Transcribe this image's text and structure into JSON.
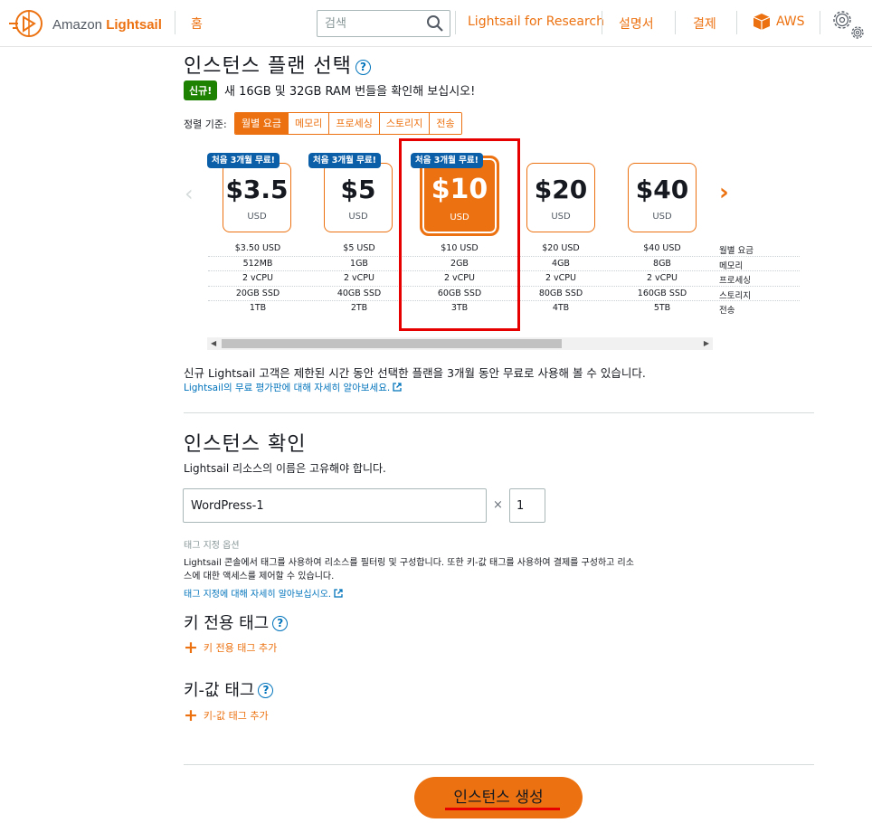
{
  "header": {
    "brand_prefix": "Amazon ",
    "brand_name": "Lightsail",
    "home": "홈",
    "search_placeholder": "검색",
    "research": "Lightsail for Research",
    "docs": "설명서",
    "billing": "결제",
    "aws": "AWS"
  },
  "plans_section": {
    "title": "인스턴스 플랜 선택",
    "help": "?",
    "new_badge": "신규!",
    "new_text": "새 16GB 및 32GB RAM 번들을 확인해 보십시오!",
    "sort_label": "정렬 기준:",
    "sort_options": [
      "월별 요금",
      "메모리",
      "프로세싱",
      "스토리지",
      "전송"
    ],
    "sort_active": "월별 요금",
    "promo": "처음 3개월 무료!",
    "plans": [
      {
        "price": "$3.5",
        "currency": "USD",
        "monthly": "$3.50 USD",
        "memory": "512MB",
        "processing": "2 vCPU",
        "storage": "20GB SSD",
        "transfer": "1TB",
        "promo": true
      },
      {
        "price": "$5",
        "currency": "USD",
        "monthly": "$5 USD",
        "memory": "1GB",
        "processing": "2 vCPU",
        "storage": "40GB SSD",
        "transfer": "2TB",
        "promo": true
      },
      {
        "price": "$10",
        "currency": "USD",
        "monthly": "$10 USD",
        "memory": "2GB",
        "processing": "2 vCPU",
        "storage": "60GB SSD",
        "transfer": "3TB",
        "promo": true,
        "selected": true
      },
      {
        "price": "$20",
        "currency": "USD",
        "monthly": "$20 USD",
        "memory": "4GB",
        "processing": "2 vCPU",
        "storage": "80GB SSD",
        "transfer": "4TB",
        "promo": false
      },
      {
        "price": "$40",
        "currency": "USD",
        "monthly": "$40 USD",
        "memory": "8GB",
        "processing": "2 vCPU",
        "storage": "160GB SSD",
        "transfer": "5TB",
        "promo": false
      }
    ],
    "row_labels": [
      "월별 요금",
      "메모리",
      "프로세싱",
      "스토리지",
      "전송"
    ],
    "free_text": "신규 Lightsail 고객은 제한된 시간 동안 선택한 플랜을 3개월 동안 무료로 사용해 볼 수 있습니다.",
    "free_link": "Lightsail의 무료 평가판에 대해 자세히 알아보세요."
  },
  "confirm_section": {
    "title": "인스턴스 확인",
    "subtitle": "Lightsail 리소스의 이름은 고유해야 합니다.",
    "name_value": "WordPress-1",
    "times": "×",
    "count_value": "1",
    "tag_options": "태그 지정 옵션",
    "tag_desc": "Lightsail 콘솔에서 태그를 사용하여 리소스를 필터링 및 구성합니다. 또한 키-값 태그를 사용하여 결제를 구성하고 리소스에 대한 액세스를 제어할 수 있습니다.",
    "tag_link": "태그 지정에 대해 자세히 알아보십시오.",
    "key_only_title": "키 전용 태그",
    "key_only_add": "키 전용 태그 추가",
    "key_value_title": "키-값 태그",
    "key_value_add": "키-값 태그 추가"
  },
  "create_button": "인스턴스 생성",
  "colors": {
    "accent": "#ec7211",
    "link": "#0073bb",
    "new_badge": "#1d8102",
    "promo": "#0b5fa8",
    "annotation": "#e60000"
  }
}
